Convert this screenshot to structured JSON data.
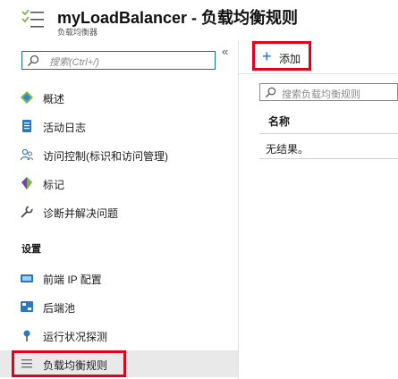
{
  "header": {
    "title": "myLoadBalancer - 负载均衡规则",
    "subtitle": "负载均衡器",
    "icon": "load-balancer-icon"
  },
  "sidebar": {
    "collapse_label": "«",
    "search_placeholder": "搜索(Ctrl+/)",
    "items": [
      {
        "label": "概述",
        "icon": "overview-icon"
      },
      {
        "label": "活动日志",
        "icon": "activity-log-icon"
      },
      {
        "label": "访问控制(标识和访问管理)",
        "icon": "access-control-icon"
      },
      {
        "label": "标记",
        "icon": "tag-icon"
      },
      {
        "label": "诊断并解决问题",
        "icon": "wrench-icon"
      }
    ],
    "settings_header": "设置",
    "settings_items": [
      {
        "label": "前端 IP 配置",
        "icon": "frontend-ip-icon"
      },
      {
        "label": "后端池",
        "icon": "backend-pool-icon"
      },
      {
        "label": "运行状况探测",
        "icon": "health-probe-icon"
      },
      {
        "label": "负载均衡规则",
        "icon": "rules-icon",
        "selected": true
      }
    ]
  },
  "main": {
    "add_button": "添加",
    "filter_placeholder": "搜索负载均衡规则",
    "column_header": "名称",
    "empty_text": "无结果。"
  },
  "colors": {
    "accent": "#0f6fb5",
    "highlight_red": "#e3001b",
    "selected_bg": "#e9e9e9"
  }
}
